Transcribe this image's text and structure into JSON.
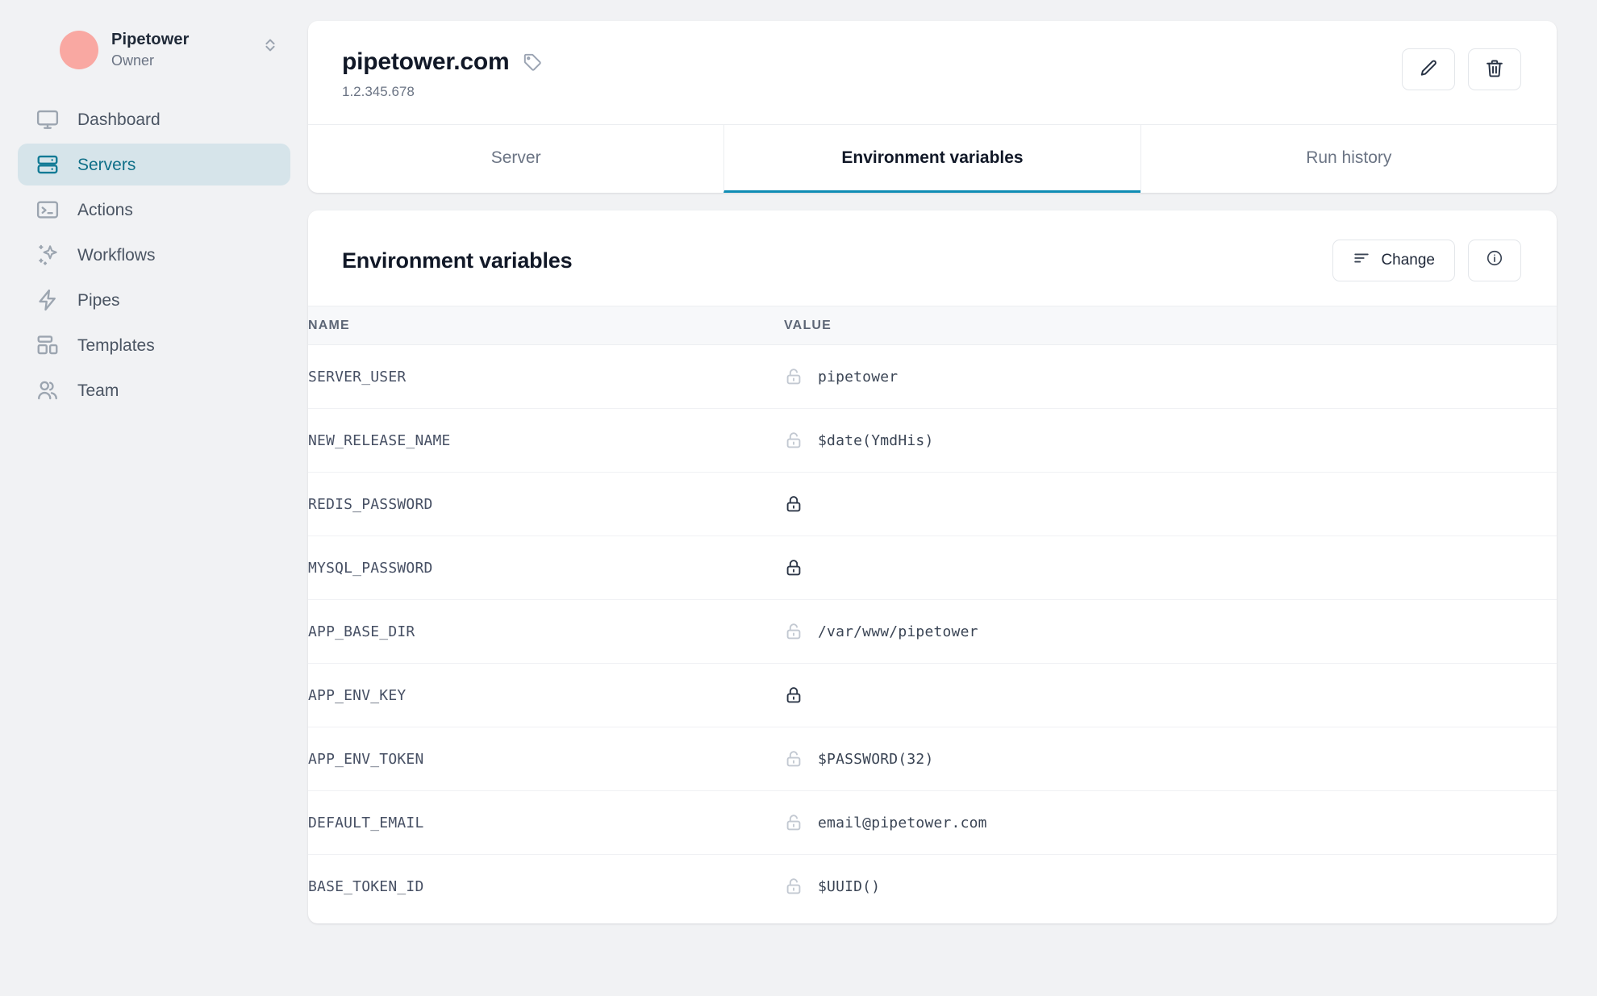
{
  "sidebar": {
    "org": {
      "name": "Pipetower",
      "role": "Owner",
      "avatar_color": "#f9a8a2"
    },
    "items": [
      {
        "label": "Dashboard",
        "icon": "monitor-icon",
        "active": false
      },
      {
        "label": "Servers",
        "icon": "server-icon",
        "active": true
      },
      {
        "label": "Actions",
        "icon": "terminal-icon",
        "active": false
      },
      {
        "label": "Workflows",
        "icon": "sparkles-icon",
        "active": false
      },
      {
        "label": "Pipes",
        "icon": "lightning-icon",
        "active": false
      },
      {
        "label": "Templates",
        "icon": "layout-icon",
        "active": false
      },
      {
        "label": "Team",
        "icon": "users-icon",
        "active": false
      }
    ]
  },
  "header": {
    "title": "pipetower.com",
    "subtitle": "1.2.345.678",
    "tag_icon": "tag-icon",
    "edit_icon": "pencil-icon",
    "delete_icon": "trash-icon"
  },
  "tabs": [
    {
      "label": "Server",
      "active": false
    },
    {
      "label": "Environment variables",
      "active": true
    },
    {
      "label": "Run history",
      "active": false
    }
  ],
  "env_section": {
    "title": "Environment variables",
    "change_label": "Change",
    "change_icon": "sort-lines-icon",
    "info_icon": "info-circle-icon",
    "columns": [
      "NAME",
      "VALUE"
    ],
    "rows": [
      {
        "name": "SERVER_USER",
        "value": "pipetower",
        "locked": false
      },
      {
        "name": "NEW_RELEASE_NAME",
        "value": "$date(YmdHis)",
        "locked": false
      },
      {
        "name": "REDIS_PASSWORD",
        "value": "",
        "locked": true
      },
      {
        "name": "MYSQL_PASSWORD",
        "value": "",
        "locked": true
      },
      {
        "name": "APP_BASE_DIR",
        "value": "/var/www/pipetower",
        "locked": false
      },
      {
        "name": "APP_ENV_KEY",
        "value": "",
        "locked": true
      },
      {
        "name": "APP_ENV_TOKEN",
        "value": "$PASSWORD(32)",
        "locked": false
      },
      {
        "name": "DEFAULT_EMAIL",
        "value": "email@pipetower.com",
        "locked": false
      },
      {
        "name": "BASE_TOKEN_ID",
        "value": "$UUID()",
        "locked": false
      }
    ]
  },
  "colors": {
    "accent_teal": "#0e8cb4",
    "active_nav_bg": "#d6e4ea",
    "active_nav_fg": "#0f6f88",
    "page_bg": "#f1f2f4"
  }
}
